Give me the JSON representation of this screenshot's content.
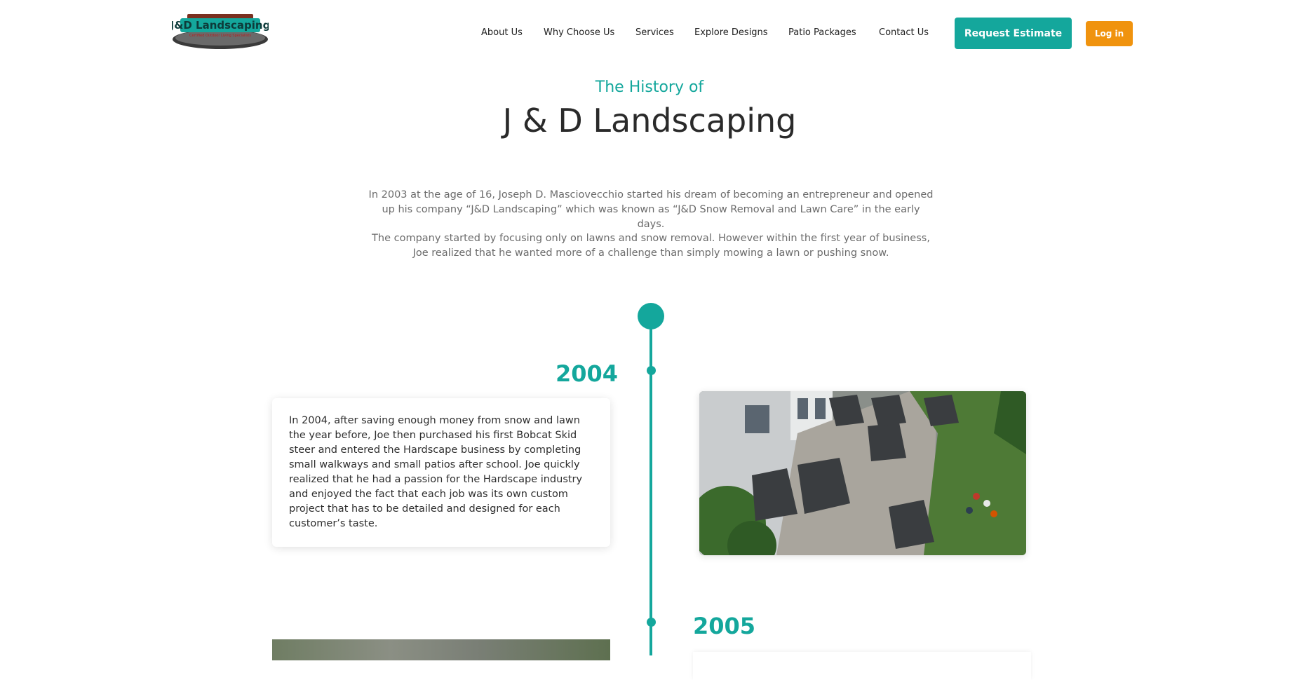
{
  "header": {
    "logo_text": "J&D Landscaping",
    "logo_tagline": "Certified Outdoor Living Specialists",
    "nav": [
      "About Us",
      "Why Choose Us",
      "Services",
      "Explore Designs",
      "Patio Packages",
      "Contact Us"
    ],
    "estimate_label": "Request Estimate",
    "login_label": "Log in"
  },
  "hero": {
    "subtitle": "The History of",
    "title": "J & D Landscaping",
    "intro_1": "In 2003 at the age of 16, Joseph D. Masciovecchio started his dream of becoming an entrepreneur and opened up his company “J&D Landscaping” which was known as “J&D Snow Removal and Lawn Care” in the early days.",
    "intro_2": "The company started by focusing only on lawns and snow removal. However within the first year of business, Joe realized that he wanted more of a challenge than simply mowing a lawn or pushing snow."
  },
  "timeline": [
    {
      "year": "2004",
      "text": "In 2004, after saving enough money from snow and lawn the year before, Joe then purchased his first Bobcat Skid steer and entered the Hardscape business by completing small walkways and small patios after school. Joe quickly realized that he had a passion for the Hardscape industry and enjoyed the fact that each job was its own custom project that has to be detailed and designed for each customer’s taste."
    },
    {
      "year": "2005",
      "text": ""
    }
  ],
  "colors": {
    "accent": "#14a79c",
    "login": "#f0930e"
  }
}
